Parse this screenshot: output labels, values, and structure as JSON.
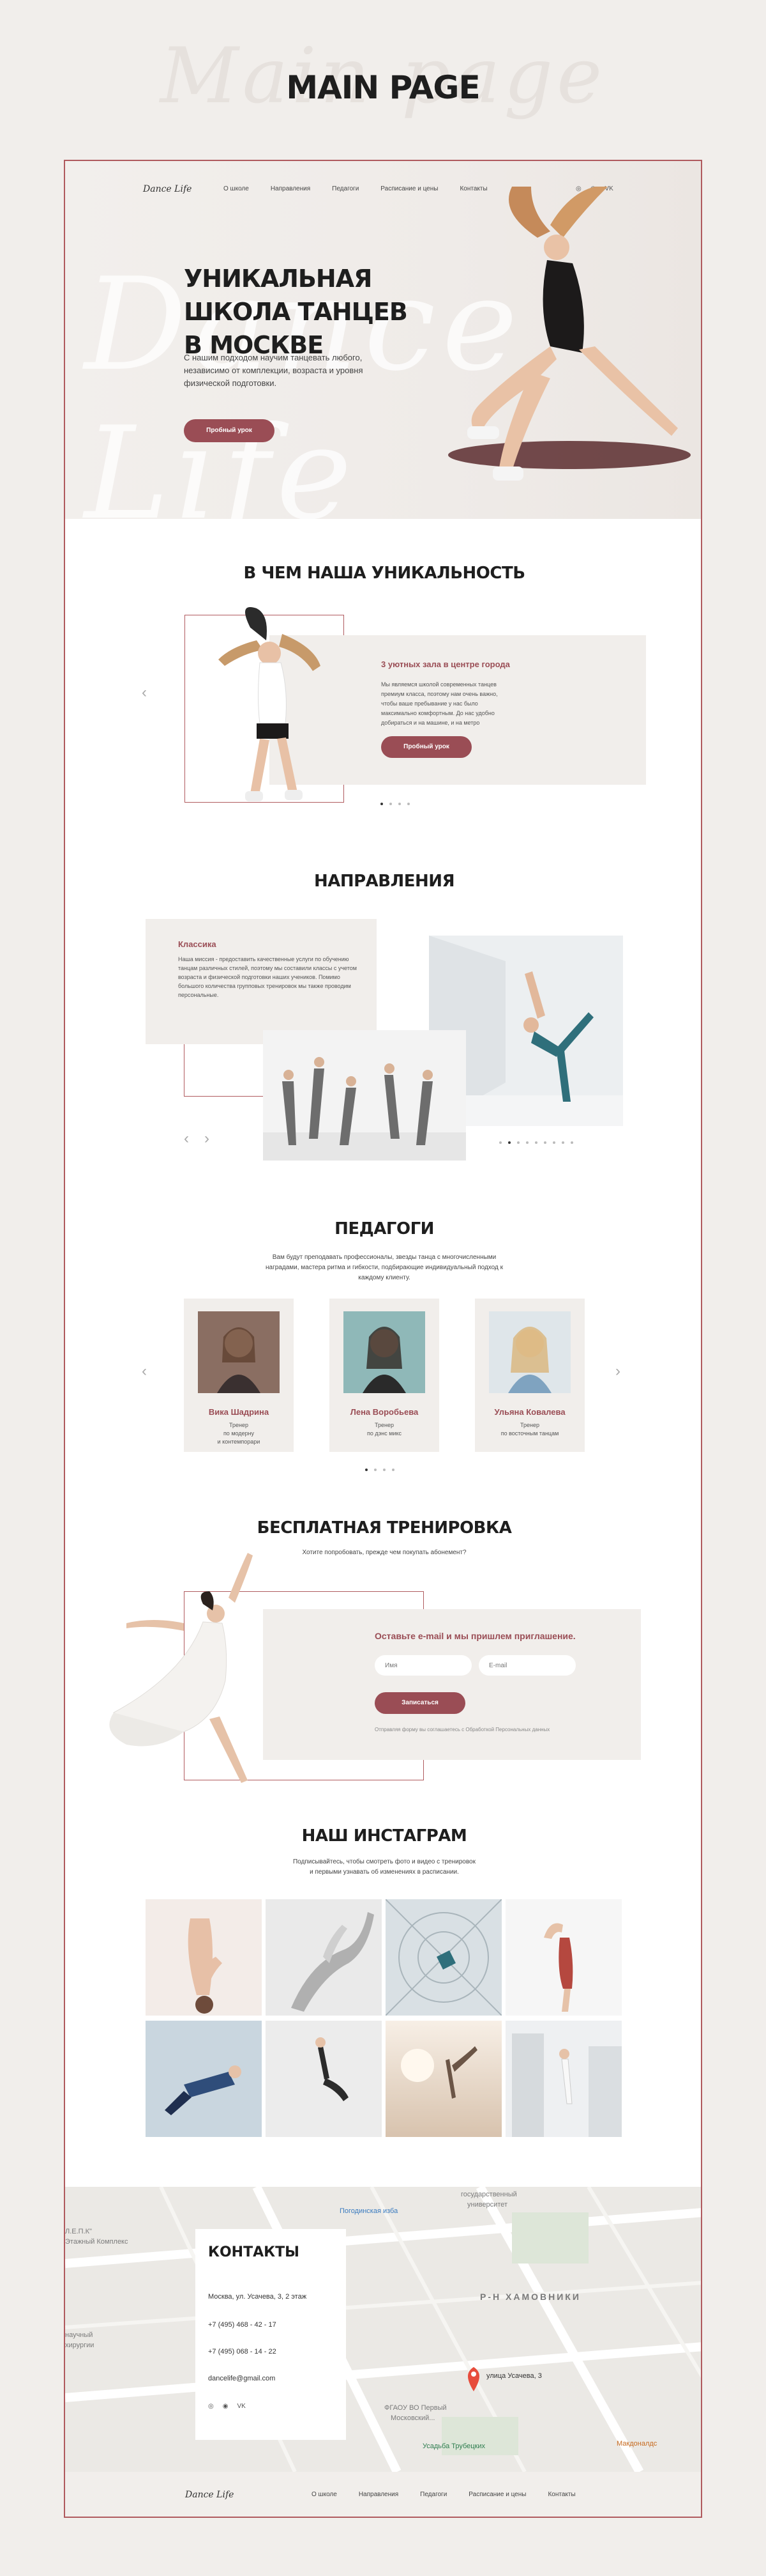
{
  "presentation": {
    "bg_title": "Main page",
    "title": "MAIN PAGE"
  },
  "nav": {
    "logo": "Dance Life",
    "links": [
      "О школе",
      "Направления",
      "Педагоги",
      "Расписание и цены",
      "Контакты"
    ],
    "social": [
      "instagram-icon",
      "whatsapp-icon",
      "vk-icon"
    ],
    "social_labels": [
      "◎",
      "◉",
      "VK"
    ]
  },
  "hero": {
    "script": "Dance Life",
    "title": "УНИКАЛЬНАЯ ШКОЛА ТАНЦЕВ В МОСКВЕ",
    "subtitle": "С нашим подходом научим танцевать любого, независимо от комплекции, возраста и уровня физической подготовки.",
    "button": "Пробный урок"
  },
  "unique": {
    "title": "В ЧЕМ НАША УНИКАЛЬНОСТЬ",
    "card_title": "3 уютных зала в центре города",
    "card_text": "Мы являемся школой современных танцев премиум класса, поэтому нам очень важно, чтобы ваше пребывание у нас было максимально комфортным. До нас удобно добираться и на машине, и на метро",
    "button": "Пробный урок",
    "arrow_left": "‹",
    "arrow_right": "›",
    "dots": 4,
    "active_dot": 0
  },
  "directions": {
    "title": "НАПРАВЛЕНИЯ",
    "card_title": "Классика",
    "card_text": "Наша миссия - предоставить качественные услуги по обучению танцам различных стилей, поэтому мы составили классы с учетом возраста и физической подготовки наших учеников. Помимо большого количества групповых тренировок мы также проводим персональные.",
    "arrow_left": "‹",
    "arrow_right": "›",
    "dots": 9,
    "active_dot": 1
  },
  "teachers": {
    "title": "ПЕДАГОГИ",
    "subtitle": "Вам будут преподавать профессионалы, звезды танца с многочисленными наградами, мастера ритма и гибкости, подбирающие индивидуальный подход к каждому клиенту.",
    "list": [
      {
        "name": "Вика Шадрина",
        "role_line1": "Тренер",
        "role_line2": "по модерну",
        "role_line3": "и контемпорари"
      },
      {
        "name": "Лена Воробьева",
        "role_line1": "Тренер",
        "role_line2": "по дэнс микс",
        "role_line3": ""
      },
      {
        "name": "Ульяна Ковалева",
        "role_line1": "Тренер",
        "role_line2": "по восточным танцам",
        "role_line3": ""
      }
    ],
    "arrow_left": "‹",
    "arrow_right": "›",
    "dots": 4,
    "active_dot": 0
  },
  "free": {
    "title": "БЕСПЛАТНАЯ ТРЕНИРОВКА",
    "subtitle": "Хотите попробовать, прежде чем покупать абонемент?",
    "form_title": "Оставьте e-mail и мы пришлем приглашение.",
    "name_placeholder": "Имя",
    "email_placeholder": "E-mail",
    "button": "Записаться",
    "note": "Отправляя форму вы соглашаетесь с Обработкой Персональных данных"
  },
  "instagram": {
    "title": "НАШ ИНСТАГРАМ",
    "subtitle_line1": "Подписывайтесь, чтобы смотреть фото и видео с тренировок",
    "subtitle_line2": "и первыми узнавать об изменениях в расписании."
  },
  "map": {
    "labels": [
      "Погодинская изба",
      "Л.Е.П.К\"",
      "Этажный Комплекс",
      "государственный",
      "университет",
      "Р-Н ХАМОВНИКИ",
      "улица Усачева, 3",
      "ФГАОУ ВО Первый",
      "Московский...",
      "Усадьба Трубецких",
      "Макдоналдс",
      "научный",
      "хирургии"
    ]
  },
  "contacts": {
    "title": "КОНТАКТЫ",
    "address": "Москва, ул. Усачева, 3, 2 этаж",
    "phone1": "+7 (495) 468 - 42 - 17",
    "phone2": "+7 (495) 068 - 14 - 22",
    "email": "dancelife@gmail.com"
  },
  "footer": {
    "logo": "Dance Life",
    "links": [
      "О школе",
      "Направления",
      "Педагоги",
      "Расписание и цены",
      "Контакты"
    ]
  },
  "colors": {
    "accent": "#9a4d55",
    "border": "#b05a5e",
    "beige": "#f1eeeb"
  }
}
